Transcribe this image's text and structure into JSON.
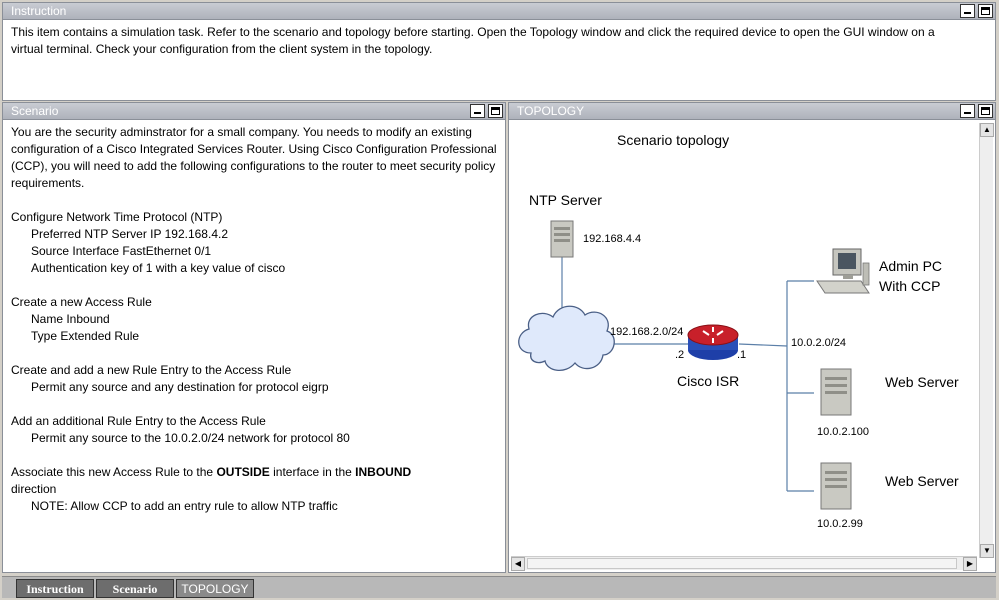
{
  "instruction": {
    "title": "Instruction",
    "text": "This item contains a simulation task. Refer to the scenario and topology before starting. Open the Topology window and click the required device to open the GUI window on a virtual terminal. Check your configuration from the client system in the topology."
  },
  "scenario": {
    "title": "Scenario",
    "intro": "You are the security adminstrator for a small company. You needs to modify an existing configuration of a Cisco Integrated Services Router. Using Cisco Configuration Professional (CCP), you will need to add the following configurations to the router to meet security policy requirements.",
    "ntp_heading": "Configure Network Time Protocol (NTP)",
    "ntp_items": [
      "Preferred NTP Server IP  192.168.4.2",
      "Source Interface  FastEthernet 0/1",
      "Authentication key of 1 with a key value of cisco"
    ],
    "rule_heading": "Create a new Access Rule",
    "rule_items": [
      "Name  Inbound",
      "Type  Extended Rule"
    ],
    "entry_heading": "Create and add a new Rule Entry to the Access Rule",
    "entry_items": [
      "Permit any source and any destination for protocol eigrp"
    ],
    "additional_heading": "Add an additional Rule Entry to the Access Rule",
    "additional_items": [
      "Permit any source to the 10.0.2.0/24 network for protocol 80"
    ],
    "assoc_pre": "Associate this new Access Rule to  the ",
    "assoc_outside": "OUTSIDE",
    "assoc_mid": " interface in the ",
    "assoc_inbound": "INBOUND",
    "assoc_post": "direction",
    "note": "NOTE: Allow CCP to add an entry rule to allow NTP traffic"
  },
  "topology": {
    "title": "TOPOLOGY",
    "diagram_title": "Scenario topology",
    "ntp_label": "NTP Server",
    "ntp_ip": "192.168.4.4",
    "wan_net": "192.168.2.0/24",
    "router_left_ip": ".2",
    "router_right_ip": ".1",
    "router_label": "Cisco ISR",
    "lan_net": "10.0.2.0/24",
    "admin_label_1": "Admin PC",
    "admin_label_2": "With CCP",
    "web1_label": "Web Server",
    "web1_ip": "10.0.2.100",
    "web2_label": "Web Server",
    "web2_ip": "10.0.2.99"
  },
  "taskbar": {
    "tabs": [
      "Instruction",
      "Scenario",
      "TOPOLOGY"
    ]
  }
}
